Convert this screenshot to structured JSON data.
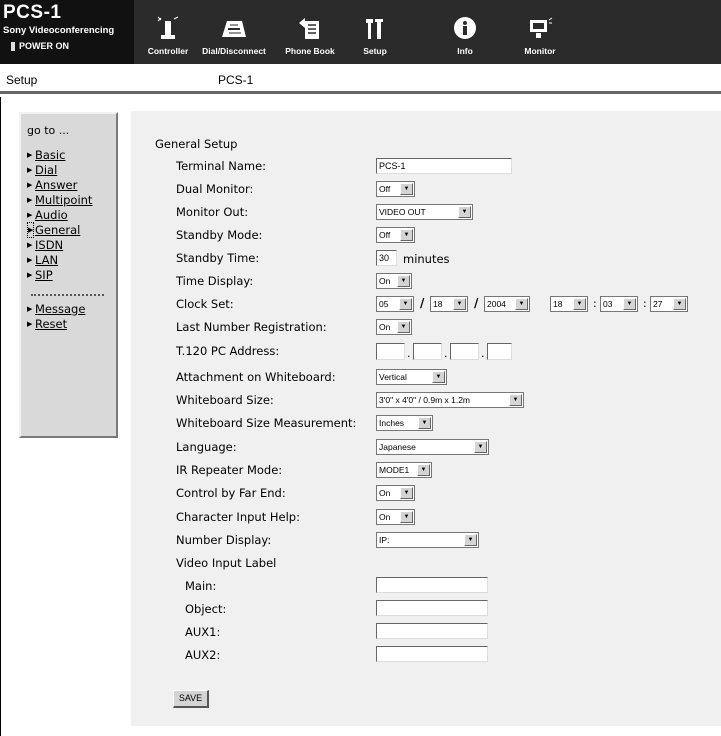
{
  "header": {
    "brand_title": "PCS-1",
    "brand_subtitle": "Sony Videoconferencing",
    "power_status": "POWER ON",
    "nav": [
      {
        "label": "Controller",
        "icon": "controller-icon"
      },
      {
        "label": "Dial/Disconnect",
        "icon": "dial-disconnect-icon"
      },
      {
        "label": "Phone Book",
        "icon": "phone-book-icon"
      },
      {
        "label": "Setup",
        "icon": "setup-icon"
      },
      {
        "label": "Info",
        "icon": "info-icon"
      },
      {
        "label": "Monitor",
        "icon": "monitor-icon"
      }
    ]
  },
  "titlebar": {
    "page": "Setup",
    "device": "PCS-1"
  },
  "sidebar": {
    "goto_label": "go to ...",
    "items": [
      {
        "label": "Basic"
      },
      {
        "label": "Dial"
      },
      {
        "label": "Answer"
      },
      {
        "label": "Multipoint"
      },
      {
        "label": "Audio"
      },
      {
        "label": "General",
        "active": true
      },
      {
        "label": "ISDN"
      },
      {
        "label": "LAN"
      },
      {
        "label": "SIP"
      }
    ],
    "extra_items": [
      {
        "label": "Message"
      },
      {
        "label": "Reset"
      }
    ]
  },
  "form": {
    "section_title": "General Setup",
    "terminal_name": {
      "label": "Terminal Name:",
      "value": "PCS-1"
    },
    "dual_monitor": {
      "label": "Dual Monitor:",
      "value": "Off"
    },
    "monitor_out": {
      "label": "Monitor Out:",
      "value": "VIDEO OUT"
    },
    "standby_mode": {
      "label": "Standby Mode:",
      "value": "Off"
    },
    "standby_time": {
      "label": "Standby Time:",
      "value": "30",
      "unit": "minutes"
    },
    "time_display": {
      "label": "Time Display:",
      "value": "On"
    },
    "clock_set": {
      "label": "Clock Set:",
      "month": "05",
      "day": "18",
      "year": "2004",
      "hour": "18",
      "minute": "03",
      "second": "27",
      "date_sep": "/",
      "time_sep": ":"
    },
    "last_number_registration": {
      "label": "Last Number Registration:",
      "value": "On"
    },
    "t120_pc_address": {
      "label": "T.120 PC Address:",
      "octets": [
        "",
        "",
        "",
        ""
      ],
      "sep": "."
    },
    "attachment_on_whiteboard": {
      "label": "Attachment on Whiteboard:",
      "value": "Vertical"
    },
    "whiteboard_size": {
      "label": "Whiteboard Size:",
      "value": "3'0\" x 4'0\" / 0.9m x 1.2m"
    },
    "whiteboard_size_measurement": {
      "label": "Whiteboard Size Measurement:",
      "value": "Inches"
    },
    "language": {
      "label": "Language:",
      "value": "Japanese"
    },
    "ir_repeater_mode": {
      "label": "IR Repeater Mode:",
      "value": "MODE1"
    },
    "control_by_far_end": {
      "label": "Control by Far End:",
      "value": "On"
    },
    "character_input_help": {
      "label": "Character Input Help:",
      "value": "On"
    },
    "number_display": {
      "label": "Number Display:",
      "value": "IP:"
    },
    "video_input_label": {
      "label": "Video Input Label",
      "main": {
        "label": "Main:",
        "value": ""
      },
      "object": {
        "label": "Object:",
        "value": ""
      },
      "aux1": {
        "label": "AUX1:",
        "value": ""
      },
      "aux2": {
        "label": "AUX2:",
        "value": ""
      }
    },
    "save_label": "SAVE"
  }
}
